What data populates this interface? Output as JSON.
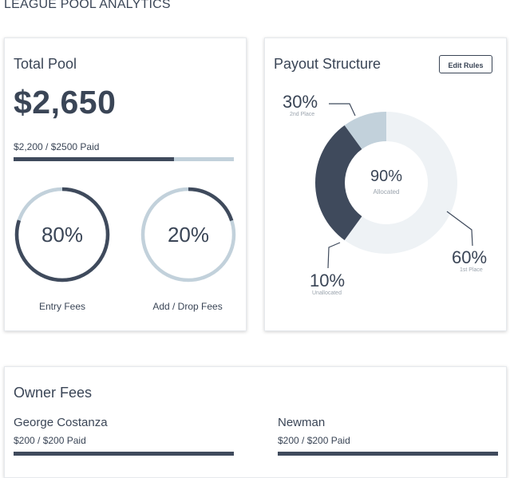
{
  "page": {
    "title": "LEAGUE POOL ANALYTICS"
  },
  "colors": {
    "dark": "#3f4a5c",
    "light": "#c2d1db",
    "pale": "#eef2f5"
  },
  "total_pool": {
    "title": "Total Pool",
    "amount": "$2,650",
    "paid_text": "$2,200 / $2500 Paid",
    "paid_fraction": 0.73,
    "rings": [
      {
        "value_text": "80%",
        "fraction": 0.8,
        "label": "Entry Fees"
      },
      {
        "value_text": "20%",
        "fraction": 0.2,
        "label": "Add / Drop Fees"
      }
    ]
  },
  "payout": {
    "title": "Payout Structure",
    "edit_label": "Edit Rules",
    "center_value": "90%",
    "center_label": "Allocated",
    "callouts": [
      {
        "value": "30%",
        "label": "2nd Place"
      },
      {
        "value": "60%",
        "label": "1st Place"
      },
      {
        "value": "10%",
        "label": "Unallocated"
      }
    ]
  },
  "chart_data": {
    "type": "pie",
    "categories": [
      "1st Place",
      "2nd Place",
      "Unallocated"
    ],
    "values": [
      60,
      30,
      10
    ]
  },
  "owner_fees": {
    "title": "Owner Fees",
    "owners": [
      {
        "name": "George Costanza",
        "paid_text": "$200 / $200 Paid",
        "paid_fraction": 1.0
      },
      {
        "name": "Newman",
        "paid_text": "$200 / $200 Paid",
        "paid_fraction": 1.0
      }
    ]
  }
}
